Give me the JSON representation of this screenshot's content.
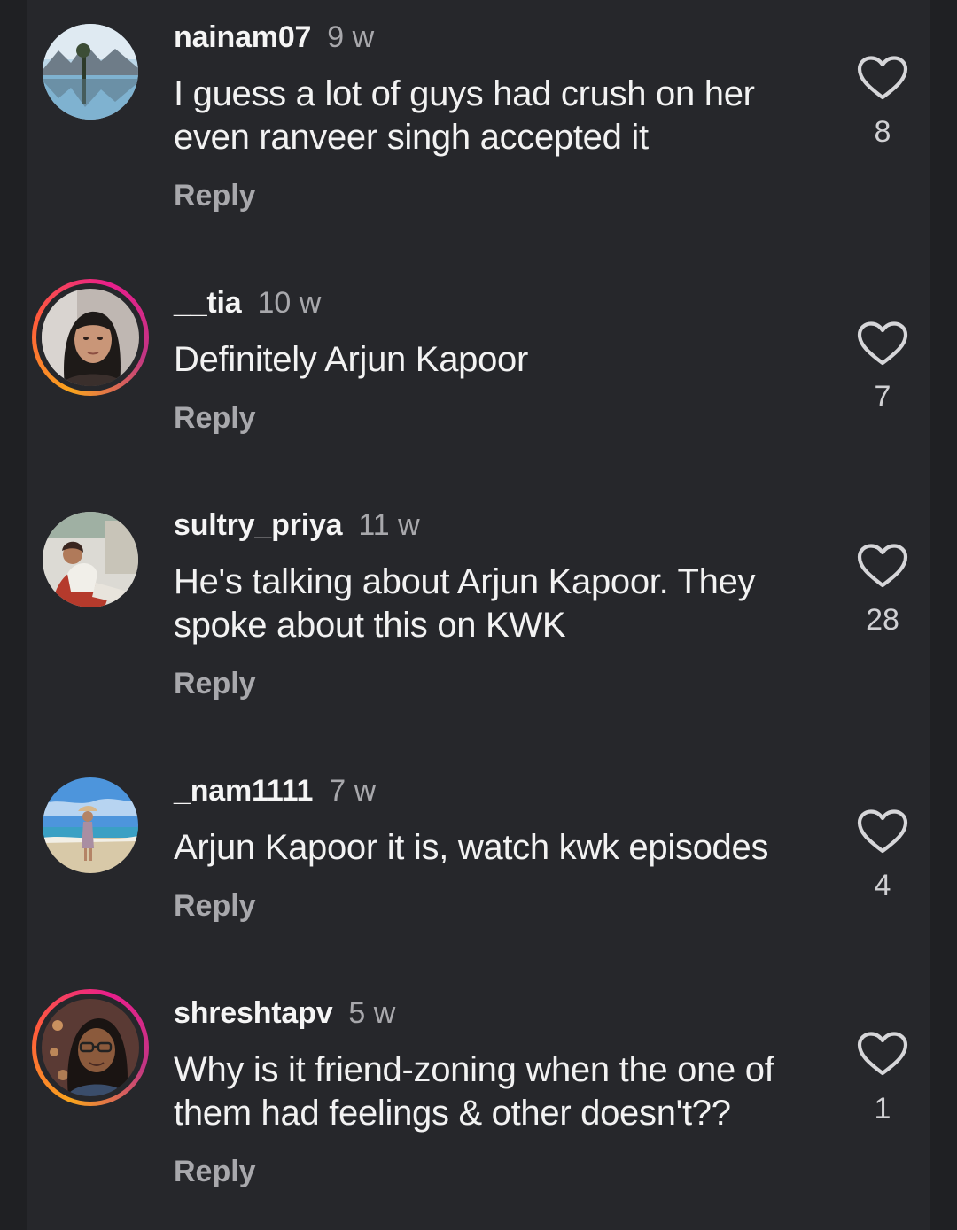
{
  "comments": [
    {
      "username": "nainam07",
      "time": "9 w",
      "text": "I guess a lot of guys had crush on her even ranveer singh accepted it",
      "reply_label": "Reply",
      "likes": "8",
      "story_ring": false
    },
    {
      "username": "__tia",
      "time": "10 w",
      "text": "Definitely Arjun Kapoor",
      "reply_label": "Reply",
      "likes": "7",
      "story_ring": true
    },
    {
      "username": "sultry_priya",
      "time": "11 w",
      "text": "He's talking about Arjun Kapoor. They spoke about this on KWK",
      "reply_label": "Reply",
      "likes": "28",
      "story_ring": false
    },
    {
      "username": "_nam1111",
      "time": "7 w",
      "text": "Arjun Kapoor it is, watch kwk episodes",
      "reply_label": "Reply",
      "likes": "4",
      "story_ring": false
    },
    {
      "username": "shreshtapv",
      "time": "5 w",
      "text": "Why is it friend-zoning when the one of them had feelings & other doesn't??",
      "reply_label": "Reply",
      "likes": "1",
      "story_ring": true
    }
  ],
  "icons": {
    "like": "heart-outline-icon"
  },
  "colors": {
    "background": "#26272b",
    "text": "#f2f2f2",
    "secondary_text": "#a8a8ac",
    "story_ring": [
      "#f9a41d",
      "#e91e8c"
    ]
  }
}
